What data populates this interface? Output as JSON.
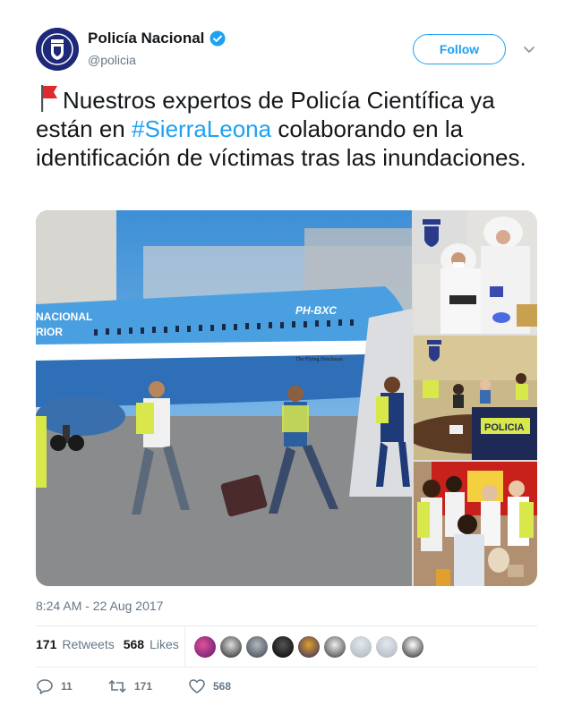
{
  "user": {
    "name": "Policía Nacional",
    "handle": "@policia",
    "follow_label": "Follow"
  },
  "tweet": {
    "text_before": "Nuestros expertos de Policía Científica ya están en ",
    "hashtag": "#SierraLeona",
    "text_after": " colaborando en la identificación de víctimas tras las inundaciones.",
    "timestamp": "8:24 AM - 22 Aug 2017"
  },
  "media": {
    "main_plane_reg": "PH-BXC",
    "main_plane_name": "The Flying Dutchman",
    "side_label": "POLICIA",
    "plane_livery_1": "NACIONAL",
    "plane_livery_2": "RIOR"
  },
  "stats": {
    "retweets_count": "171",
    "retweets_label": "Retweets",
    "likes_count": "568",
    "likes_label": "Likes"
  },
  "actions": {
    "replies": "11",
    "retweets": "171",
    "likes": "568"
  },
  "colors": {
    "accent": "#1da1f2",
    "text": "#14171a",
    "muted": "#657786"
  },
  "icons": [
    "verified-badge-icon",
    "chevron-down-icon",
    "red-flag-emoji-icon",
    "reply-icon",
    "retweet-icon",
    "heart-icon"
  ]
}
